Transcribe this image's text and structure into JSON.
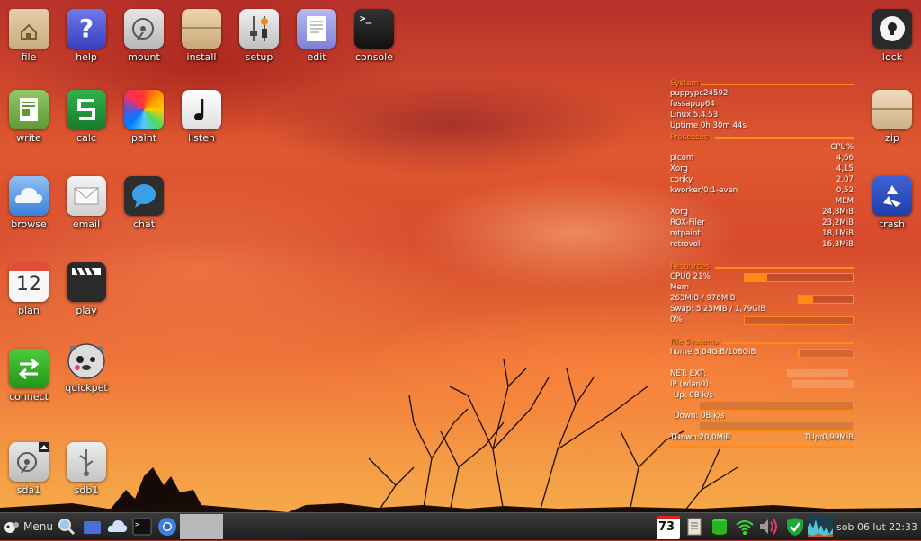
{
  "desktop": {
    "icons": {
      "file": "file",
      "help": "help",
      "mount": "mount",
      "install": "install",
      "setup": "setup",
      "edit": "edit",
      "console": "console",
      "write": "write",
      "calc": "calc",
      "paint": "paint",
      "listen": "listen",
      "browse": "browse",
      "email": "email",
      "chat": "chat",
      "plan": "plan",
      "plan_day": "12",
      "play": "play",
      "connect": "connect",
      "quickpet": "quickpet",
      "sda1": "sda1",
      "sdb1": "sdb1",
      "lock": "lock",
      "zip": "zip",
      "trash": "trash"
    }
  },
  "conky": {
    "system": {
      "header": "System",
      "hostname": "puppypc24592",
      "distro": "fossapup64",
      "kernel": "Linux 5.4.53",
      "uptime": "Uptime 0h 30m 44s"
    },
    "processes": {
      "header": "Processes",
      "cpu_label": "CPU%",
      "cpu": [
        {
          "name": "picom",
          "val": "4,66"
        },
        {
          "name": "Xorg",
          "val": "4,15"
        },
        {
          "name": "conky",
          "val": "2,07"
        },
        {
          "name": "kworker/0:1-even",
          "val": "0,52"
        }
      ],
      "mem_label": "MEM",
      "mem": [
        {
          "name": "Xorg",
          "val": "24,8MiB"
        },
        {
          "name": "ROX-Filer",
          "val": "23,2MiB"
        },
        {
          "name": "mtpaint",
          "val": "18,1MiB"
        },
        {
          "name": "retrovol",
          "val": "16,3MiB"
        }
      ]
    },
    "resources": {
      "header": "Resources",
      "cpu0": "CPU0 21%",
      "cpu0_level": 0.21,
      "mem_label": "Mem",
      "mem_used": "263MiB / 976MiB",
      "mem_level": 0.27,
      "swap": "Swap: 5,25MiB / 1,79GiB",
      "swap_pct": "0%",
      "swap_level": 0.0
    },
    "filesystems": {
      "header": "File Systems",
      "home": "home 3,04GiB/108GiB",
      "home_level": 0.03
    },
    "net": {
      "net_ext": "NET: EXT:",
      "ip": "IP (wlan0):",
      "up": "Up: 0B   k/s",
      "down": "Down: 0B  k/s",
      "tdown": "TDown:20,0MiB",
      "tup": "TUp:0,99MiB"
    }
  },
  "taskbar": {
    "menu_label": "Menu",
    "update_badge": "73",
    "clock": "sob 06 lut 22:33"
  },
  "colors": {
    "accent": "#ff8a1a",
    "taskbar_bg": "#262626"
  }
}
